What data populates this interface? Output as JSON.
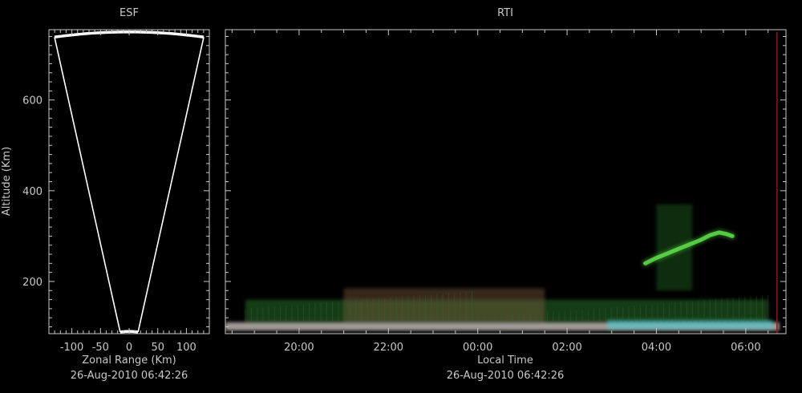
{
  "chart_data": [
    {
      "type": "scatter",
      "title": "ESF",
      "xlabel": "Zonal Range (Km)",
      "ylabel": "Altitude (Km)",
      "footer": "26-Aug-2010 06:42:26",
      "xlim": [
        -140,
        140
      ],
      "ylim": [
        85,
        755
      ],
      "xticks": [
        -100,
        -50,
        0,
        50,
        100
      ],
      "xtick_labels": [
        "-100",
        "-50",
        "0",
        "50",
        "100"
      ],
      "yticks": [
        200,
        400,
        600
      ],
      "ytick_labels": [
        "200",
        "400",
        "600"
      ],
      "beam_outline": {
        "min_range_km": 90,
        "max_range_km": 750,
        "half_angle_deg": 10,
        "color": "#ffffff"
      }
    },
    {
      "type": "heatmap",
      "title": "RTI",
      "xlabel": "Local Time",
      "footer": "26-Aug-2010 06:42:26",
      "xlim": [
        18.35,
        30.9
      ],
      "ylim": [
        85,
        755
      ],
      "xticks": [
        20,
        22,
        24,
        26,
        28,
        30
      ],
      "xtick_labels": [
        "20:00",
        "22:00",
        "00:00",
        "02:00",
        "04:00",
        "06:00"
      ],
      "yticks": [
        200,
        400,
        600
      ],
      "background": "#000000",
      "marker_time": 30.7,
      "marker_color": "#8b1a1a",
      "features": [
        {
          "t_start": 18.35,
          "t_end": 30.75,
          "alt_low": 92,
          "alt_high": 110,
          "color": "#d8d0cc"
        },
        {
          "t_start": 26.9,
          "t_end": 30.6,
          "alt_low": 95,
          "alt_high": 115,
          "color": "#40d0d8"
        },
        {
          "t_start": 21.0,
          "t_end": 25.5,
          "alt_low": 110,
          "alt_high": 185,
          "color": "#7a5a40"
        },
        {
          "t_start": 18.8,
          "t_end": 30.5,
          "alt_low": 110,
          "alt_high": 160,
          "color": "#2a7a2a"
        },
        {
          "t_start": 28.0,
          "t_end": 28.8,
          "alt_low": 180,
          "alt_high": 370,
          "color": "#1f5a1f"
        }
      ],
      "plume": [
        {
          "t": 27.75,
          "alt": 240
        },
        {
          "t": 28.0,
          "alt": 252
        },
        {
          "t": 28.25,
          "alt": 262
        },
        {
          "t": 28.5,
          "alt": 272
        },
        {
          "t": 28.75,
          "alt": 282
        },
        {
          "t": 29.0,
          "alt": 292
        },
        {
          "t": 29.2,
          "alt": 302
        },
        {
          "t": 29.4,
          "alt": 308
        },
        {
          "t": 29.55,
          "alt": 305
        },
        {
          "t": 29.7,
          "alt": 300
        }
      ],
      "plume_color": "#5ee04a"
    }
  ]
}
